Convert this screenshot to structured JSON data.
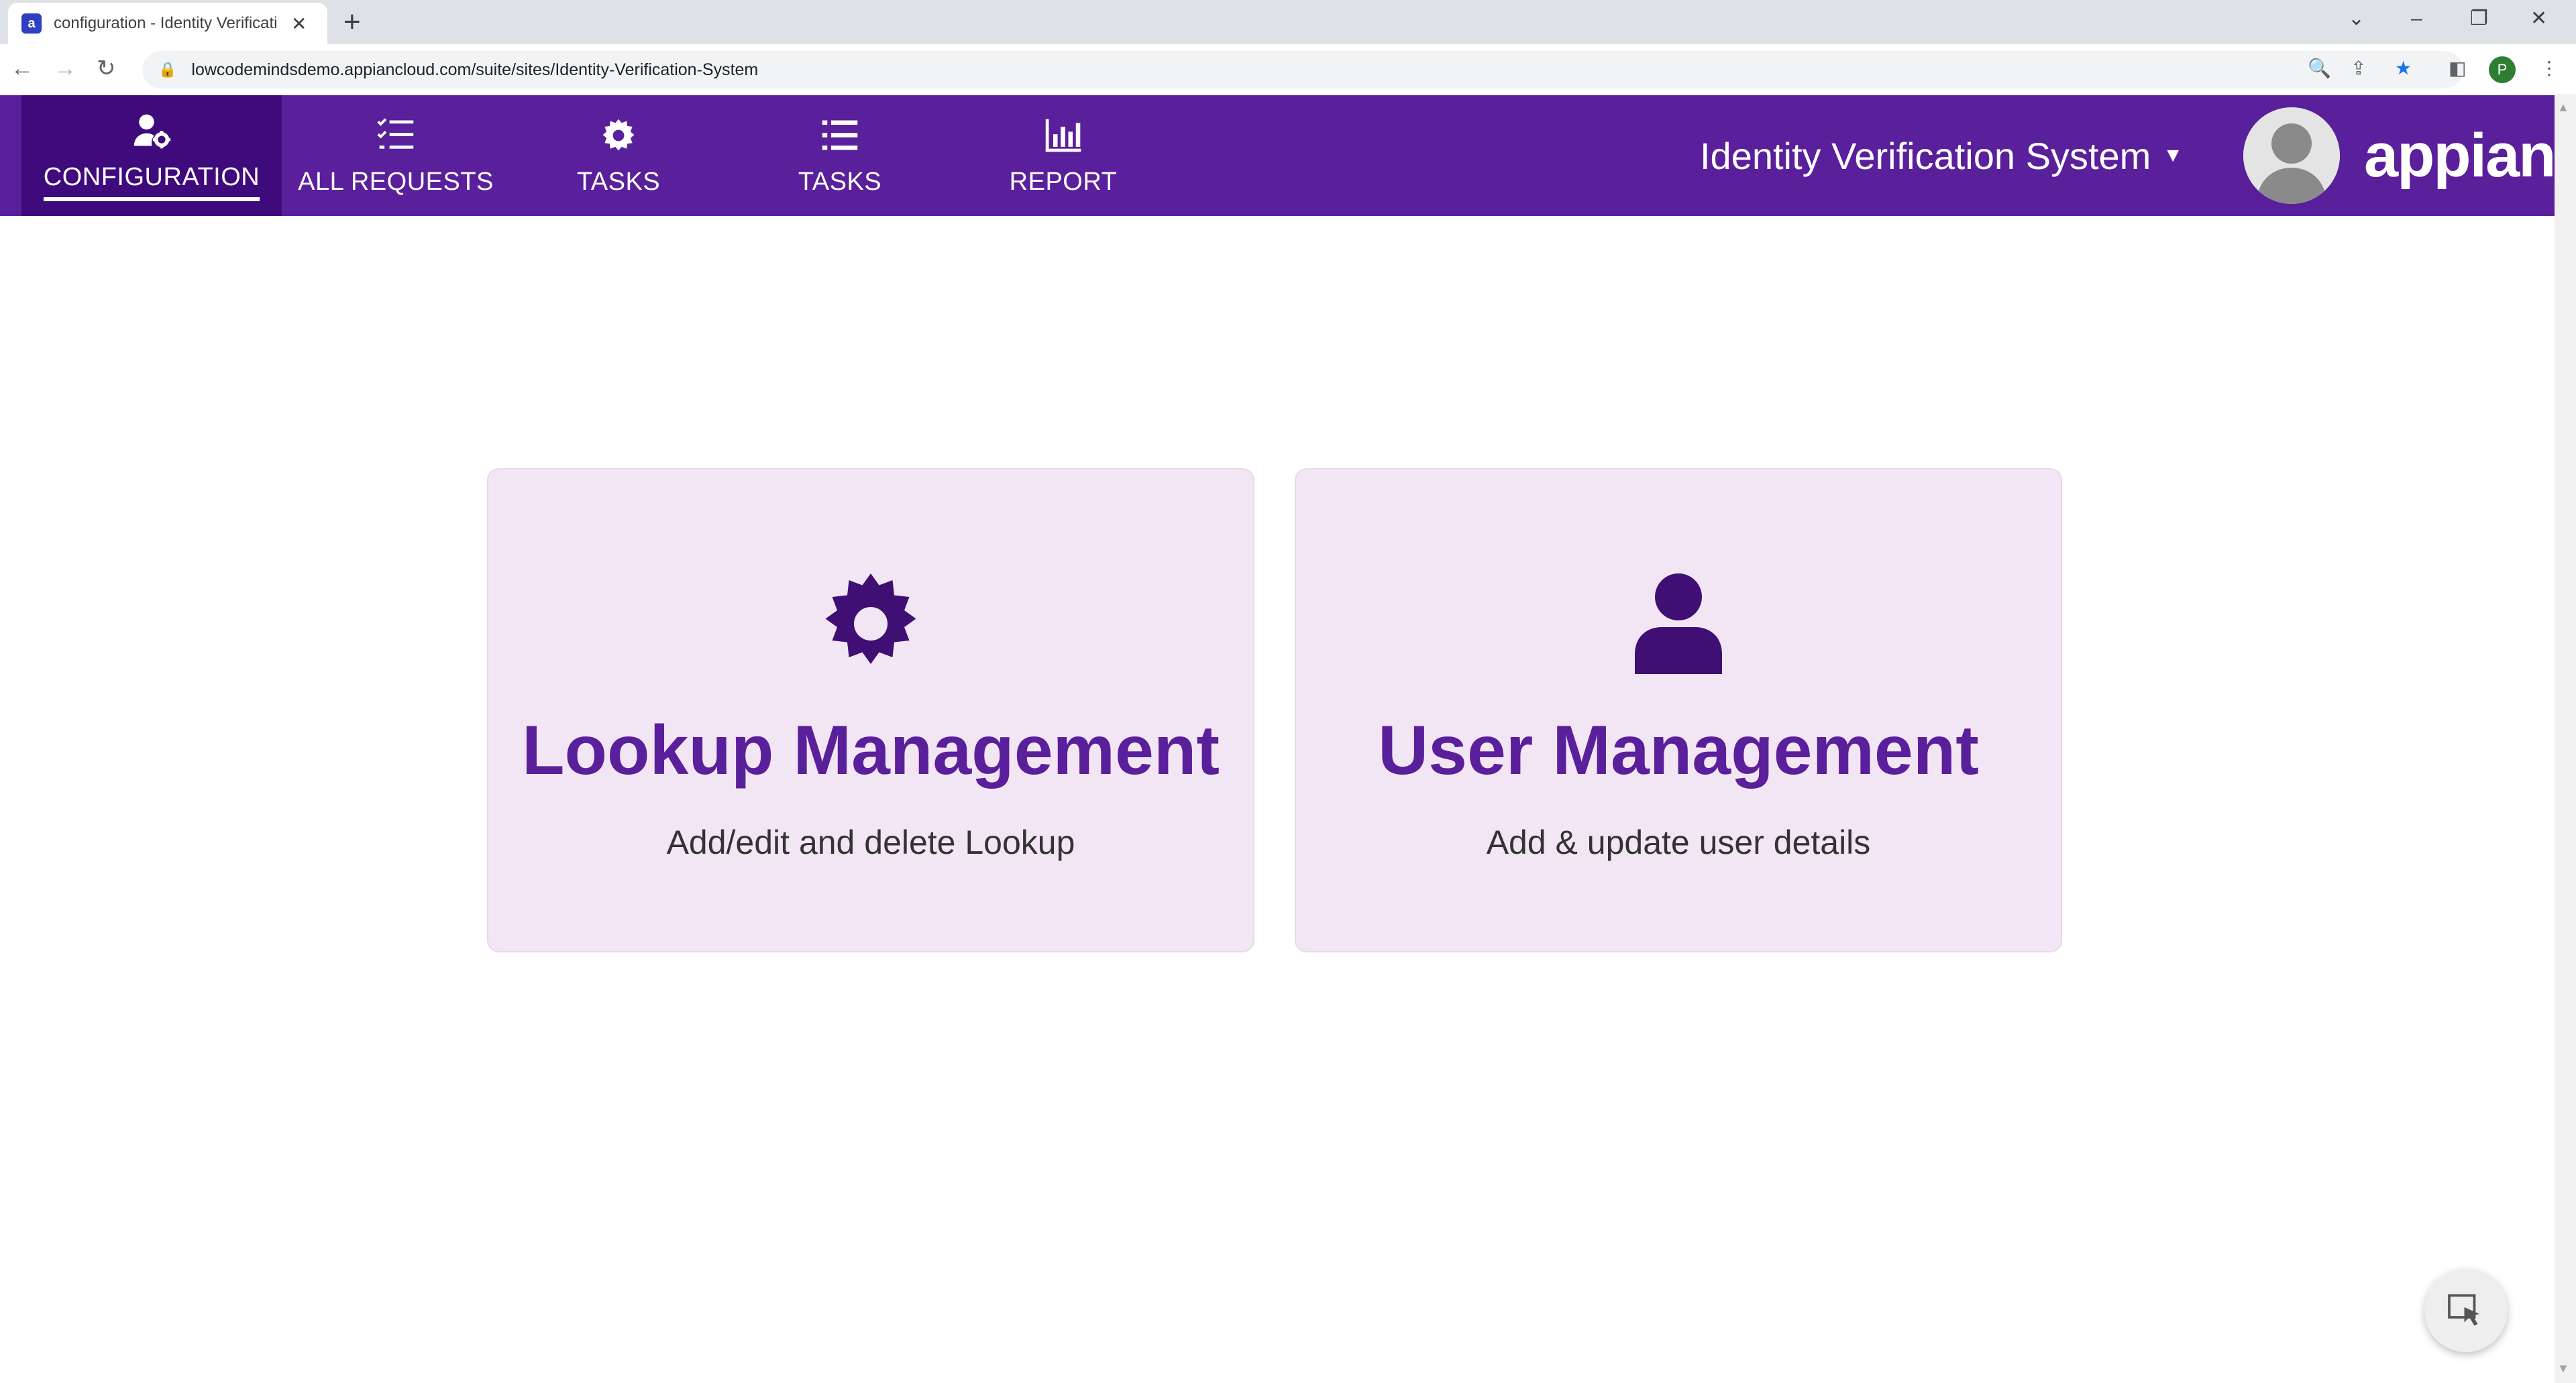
{
  "browser": {
    "tab_title": "configuration - Identity Verificati",
    "tab_favicon_letter": "a",
    "url": "lowcodemindsdemo.appiancloud.com/suite/sites/Identity-Verification-System",
    "profile_initial": "P"
  },
  "header": {
    "nav": [
      {
        "label": "CONFIGURATION",
        "icon": "user-cog-icon",
        "active": true
      },
      {
        "label": "ALL REQUESTS",
        "icon": "checklist-icon",
        "active": false
      },
      {
        "label": "TASKS",
        "icon": "gear-icon",
        "active": false
      },
      {
        "label": "TASKS",
        "icon": "list-icon",
        "active": false
      },
      {
        "label": "REPORT",
        "icon": "bar-chart-icon",
        "active": false
      }
    ],
    "site_title": "Identity Verification System",
    "brand": "appian"
  },
  "cards": [
    {
      "title": "Lookup Management",
      "description": "Add/edit and delete Lookup",
      "icon": "gear-icon"
    },
    {
      "title": "User Management",
      "description": "Add & update user details",
      "icon": "user-icon"
    }
  ],
  "colors": {
    "header_bg": "#5a1f9b",
    "active_nav_bg": "#3e0a7c",
    "card_bg": "#f3e6f4",
    "card_title": "#5a1f9b",
    "icon": "#3f0f73"
  }
}
